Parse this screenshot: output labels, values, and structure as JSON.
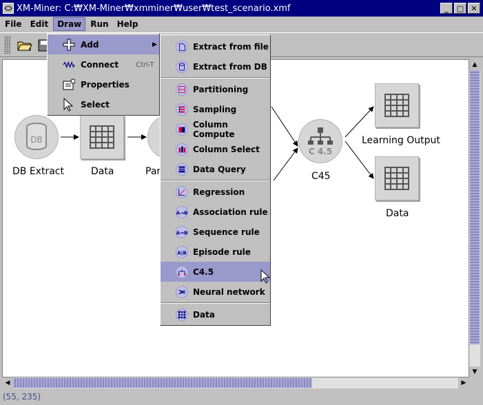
{
  "window": {
    "title": "XM-Miner: C:₩XM-Miner₩xmminer₩user₩test_scenario.xmf"
  },
  "menubar": {
    "items": [
      "File",
      "Edit",
      "Draw",
      "Run",
      "Help"
    ],
    "active": "Draw"
  },
  "draw_menu": {
    "items": [
      {
        "label": "Add",
        "icon": "add-icon",
        "submenu": true
      },
      {
        "label": "Connect",
        "icon": "connect-icon",
        "shortcut": "Ctrl-T"
      },
      {
        "label": "Properties",
        "icon": "properties-icon"
      },
      {
        "label": "Select",
        "icon": "select-cursor-icon"
      }
    ]
  },
  "add_submenu": {
    "groups": [
      [
        {
          "label": "Extract from file",
          "icon": "extract-file-icon"
        },
        {
          "label": "Extract from DB",
          "icon": "extract-db-icon"
        }
      ],
      [
        {
          "label": "Partitioning",
          "icon": "partitioning-icon"
        },
        {
          "label": "Sampling",
          "icon": "sampling-icon"
        },
        {
          "label": "Column Compute",
          "icon": "column-compute-icon"
        },
        {
          "label": "Column Select",
          "icon": "column-select-icon"
        },
        {
          "label": "Data Query",
          "icon": "data-query-icon"
        }
      ],
      [
        {
          "label": "Regression",
          "icon": "regression-icon"
        },
        {
          "label": "Association rule",
          "icon": "association-icon"
        },
        {
          "label": "Sequence rule",
          "icon": "sequence-icon"
        },
        {
          "label": "Episode rule",
          "icon": "episode-icon"
        },
        {
          "label": "C4.5",
          "icon": "c45-icon",
          "selected": true
        },
        {
          "label": "Neural network",
          "icon": "neural-network-icon"
        }
      ],
      [
        {
          "label": "Data",
          "icon": "data-grid-icon"
        }
      ]
    ]
  },
  "canvas": {
    "nodes": [
      {
        "label": "DB Extract",
        "icon_text": "DB"
      },
      {
        "label": "Data"
      },
      {
        "label": "Par"
      },
      {
        "label": "C45",
        "icon_text": "C 4.5"
      },
      {
        "label": "Learning Output"
      },
      {
        "label": "Data"
      }
    ]
  },
  "status": {
    "coords": "(55, 235)"
  },
  "colors": {
    "title_bg": "#000080",
    "highlight": "#9999cc",
    "status_text": "#4a4a8a"
  }
}
